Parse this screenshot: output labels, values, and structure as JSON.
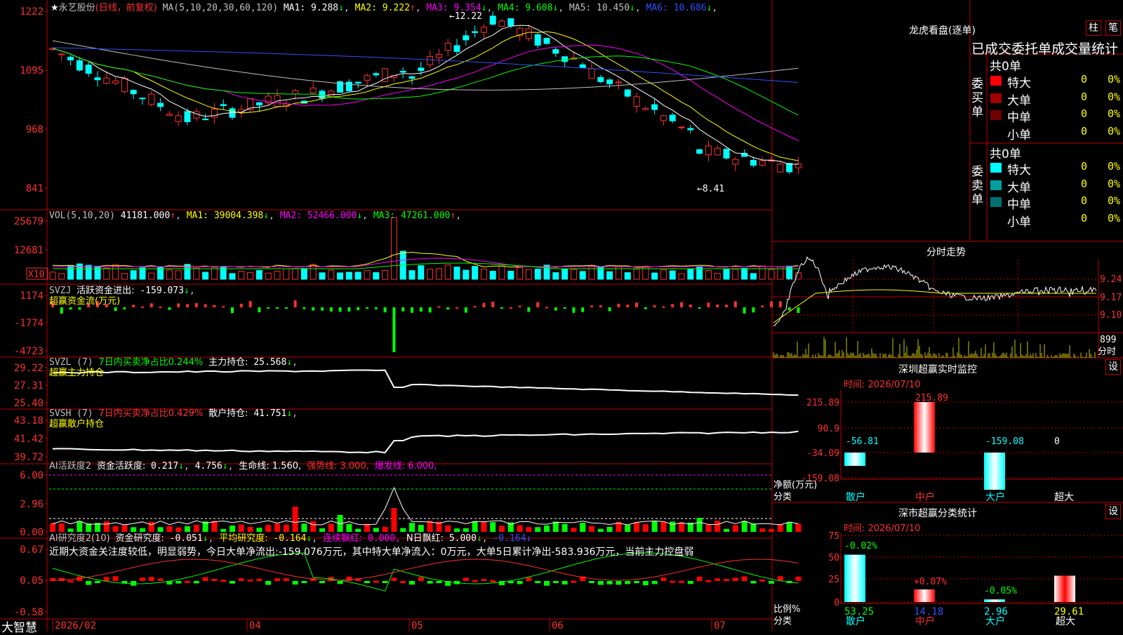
{
  "app": {
    "brand": "大智慧"
  },
  "kline": {
    "header": {
      "stock": "永艺股份",
      "mode": "(日线，前复权)",
      "ma_label": "MA(5,10,20,30,60,120)",
      "ma": [
        {
          "name": "MA1",
          "value": "9.288",
          "color": "#ffffff"
        },
        {
          "name": "MA2",
          "value": "9.222",
          "color": "#ffff00"
        },
        {
          "name": "MA3",
          "value": "9.354",
          "color": "#ff00ff"
        },
        {
          "name": "MA4",
          "value": "9.608",
          "color": "#00ff00"
        },
        {
          "name": "MA5",
          "value": "10.450",
          "color": "#c0c0c0"
        },
        {
          "name": "MA6",
          "value": "10.686",
          "color": "#3050ff"
        }
      ]
    },
    "y_ticks": [
      "1222",
      "1095",
      "968",
      "841"
    ],
    "high_label": "12.22",
    "low_label": "8.41"
  },
  "vol": {
    "header": "VOL(5,10,20)",
    "value": "41181.000",
    "ma": [
      {
        "name": "MA1",
        "value": "39004.398",
        "color": "#ffff00"
      },
      {
        "name": "MA2",
        "value": "52466.000",
        "color": "#ff00ff"
      },
      {
        "name": "MA3",
        "value": "47261.000",
        "color": "#00ff00"
      }
    ],
    "y_ticks": [
      "25679",
      "12681"
    ],
    "unit": "X10"
  },
  "svzj": {
    "name": "SVZJ",
    "label": "活跃资金进出:",
    "value": "-159.073",
    "subtitle": "超赢资金流(万元)",
    "y_ticks": [
      "1174",
      "-1774",
      "-4723"
    ]
  },
  "svzl": {
    "name": "SVZL (7)",
    "label1": "7日内买卖净占比0.244%",
    "label2": "主力持仓:",
    "value": "25.568",
    "subtitle": "超赢主力持仓",
    "y_ticks": [
      "29.22",
      "27.31",
      "25.40"
    ]
  },
  "svsh": {
    "name": "SVSH (7)",
    "label1": "7日内买卖净占比0.429%",
    "label2": "散户持仓:",
    "value": "41.751",
    "subtitle": "超赢散户持仓",
    "y_ticks": [
      "43.18",
      "41.42",
      "39.72"
    ]
  },
  "ai1": {
    "name": "AI活跃度2",
    "label": "资金活跃度:",
    "v1": "0.217",
    "v2": "4.756",
    "life": "生命线: 1.560,",
    "strong": "强势线: 3.000,",
    "burst": "爆发线: 6.000,",
    "y_ticks": [
      "6.00",
      "2.96",
      "0.00"
    ]
  },
  "ai2": {
    "name": "AI研究度2(10)",
    "label": "资金研究度:",
    "v1": "-0.051",
    "avg": "平均研究度:",
    "v2": "-0.164",
    "lian": "连续飘红:",
    "v3": "0.000,",
    "nri": "N日飘红:",
    "v4": "5.000",
    "v5": "-0.164",
    "note": "近期大资金关注度较低，明显弱势，今日大单净流出:-159.076万元，其中特大单净流入：0万元，大单5日累计净出-583.936万元，当前主力控盘弱",
    "y_ticks": [
      "0.67",
      "0.05",
      "-0.58"
    ]
  },
  "xaxis": [
    "2026/02",
    "04",
    "05",
    "06",
    "07"
  ],
  "longhu": {
    "title": "龙虎看盘(逐单)",
    "btn1": "柱",
    "btn2": "笔",
    "subtitle": "已成交委托单成交量统计",
    "buy": {
      "label": "委买单",
      "count": "共0单",
      "rows": [
        {
          "name": "特大",
          "n": "0",
          "p": "0%",
          "color": "#ff0000"
        },
        {
          "name": "大单",
          "n": "0",
          "p": "0%",
          "color": "#a00000"
        },
        {
          "name": "中单",
          "n": "0",
          "p": "0%",
          "color": "#700000"
        },
        {
          "name": "小单",
          "n": "0",
          "p": "0%",
          "color": "#000000"
        }
      ]
    },
    "sell": {
      "label": "委卖单",
      "count": "共0单",
      "rows": [
        {
          "name": "特大",
          "n": "0",
          "p": "0%",
          "color": "#00ffff"
        },
        {
          "name": "大单",
          "n": "0",
          "p": "0%",
          "color": "#00a0a0"
        },
        {
          "name": "中单",
          "n": "0",
          "p": "0%",
          "color": "#007070"
        },
        {
          "name": "小单",
          "n": "0",
          "p": "0%",
          "color": "#000000"
        }
      ]
    }
  },
  "fenshi": {
    "title": "分时走势",
    "y_ticks": [
      "9.24",
      "9.17",
      "9.10"
    ],
    "vol_tick": "899",
    "vol_label": "分时"
  },
  "monitor": {
    "title": "深圳超赢实时监控",
    "btn": "设",
    "date": "时间: 2026/07/10",
    "y_ticks": [
      "215.89",
      "90.9",
      "-34.09",
      "-159.08"
    ],
    "ylabel": "净额(万元)",
    "xlabel": "分类",
    "chart_data": {
      "type": "bar",
      "categories": [
        "散户",
        "中户",
        "大户",
        "超大"
      ],
      "values": [
        -56.81,
        215.89,
        -159.08,
        0
      ],
      "ylim": [
        -159.08,
        215.89
      ]
    }
  },
  "classify": {
    "title": "深市超赢分类统计",
    "btn": "设",
    "date": "时间: 2026/07/10",
    "y_ticks": [
      "75",
      "50",
      "25",
      "0"
    ],
    "ylabel": "比例%",
    "xlabel": "分类",
    "chart_data": {
      "type": "bar",
      "categories": [
        "散户",
        "中户",
        "大户",
        "超大"
      ],
      "values": [
        53.25,
        14.18,
        2.96,
        29.61
      ],
      "changes": [
        "-0.02%",
        "+0.07%",
        "-0.05%",
        ""
      ],
      "ylim": [
        0,
        75
      ]
    }
  }
}
